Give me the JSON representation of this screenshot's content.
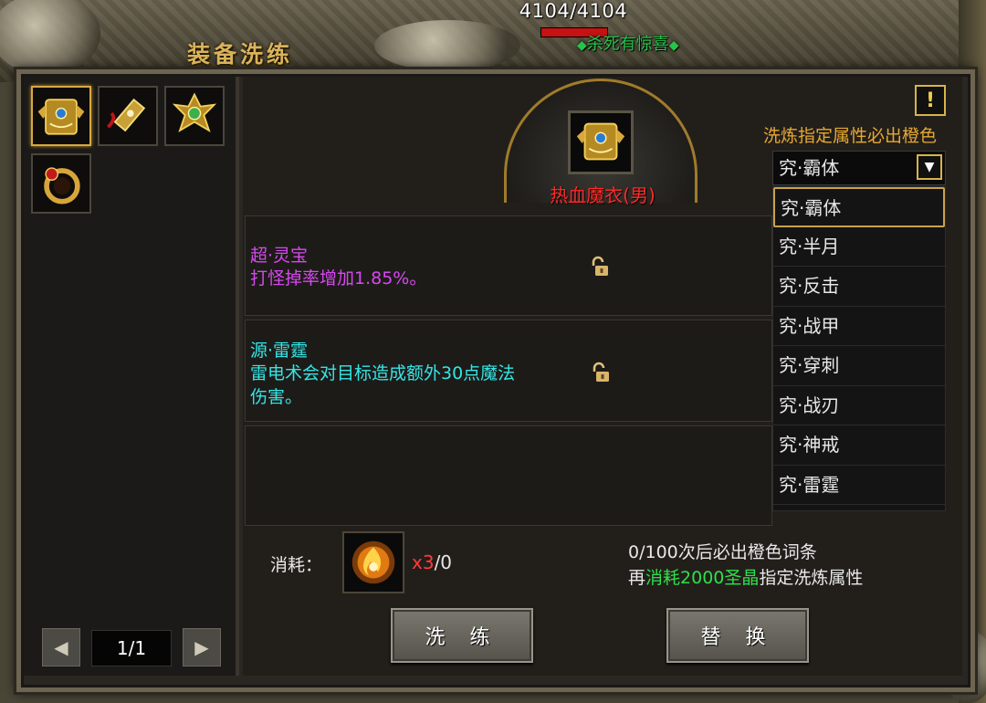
{
  "hud": {
    "hp_text": "4104/4104",
    "hp_fraction": 1.0,
    "kill_tip": "杀死有惊喜"
  },
  "window": {
    "title": "装备洗练"
  },
  "equipment_slots": [
    {
      "icon": "gold-armor-icon",
      "selected": true
    },
    {
      "icon": "gold-bracer-icon",
      "selected": false
    },
    {
      "icon": "gold-amulet-icon",
      "selected": false
    },
    {
      "icon": "gold-ring-icon",
      "selected": false
    }
  ],
  "pager": {
    "prev_icon": "left-arrow-icon",
    "label": "1/1",
    "next_icon": "right-arrow-icon"
  },
  "item": {
    "name": "热血魔衣(男)",
    "icon": "gold-armor-icon"
  },
  "hint": {
    "warning_symbol": "!",
    "orange_rule": "洗炼指定属性必出橙色"
  },
  "select": {
    "value": "究·霸体",
    "arrow": "▼",
    "options": [
      "究·霸体",
      "究·半月",
      "究·反击",
      "究·战甲",
      "究·穿刺",
      "究·战刃",
      "究·神戒",
      "究·雷霆"
    ]
  },
  "attributes": [
    {
      "title": "超·灵宝",
      "desc": [
        "打怪掉率增加1.85%。"
      ],
      "color": "#d648f0",
      "lock_icon": "unlocked-padlock-icon"
    },
    {
      "title": "源·雷霆",
      "desc": [
        "雷电术会对目标造成额外30点魔法",
        "伤害。"
      ],
      "color": "#34e6e6",
      "lock_icon": "unlocked-padlock-icon"
    }
  ],
  "cost": {
    "label": "消耗：",
    "item_icon": "flame-orb-icon",
    "required": "x3",
    "owned": "/0"
  },
  "info": {
    "line1": "0/100次后必出橙色词条",
    "line2_prefix": "再",
    "line2_highlight": "消耗2000圣晶",
    "line2_suffix": "指定洗炼属性"
  },
  "buttons": {
    "refine": "洗 练",
    "replace": "替 换"
  }
}
